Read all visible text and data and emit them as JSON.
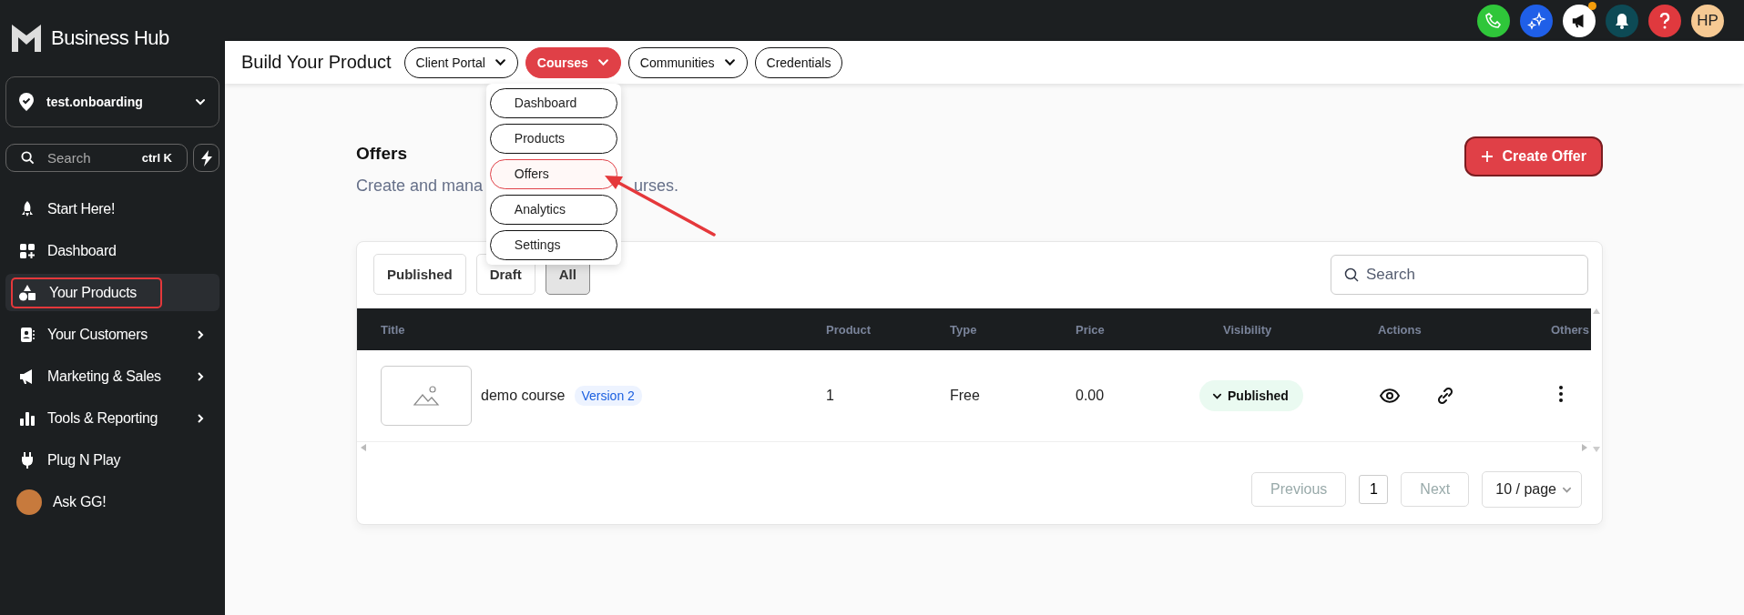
{
  "app": {
    "brand": "Business Hub"
  },
  "sidebar": {
    "account": "test.onboarding",
    "search": {
      "placeholder": "Search",
      "shortcut": "ctrl K"
    },
    "items": [
      {
        "label": "Start Here!",
        "kind": "rocket",
        "has_submenu": false,
        "selected": false
      },
      {
        "label": "Dashboard",
        "kind": "grid",
        "has_submenu": false,
        "selected": false
      },
      {
        "label": "Your Products",
        "kind": "shapes",
        "has_submenu": false,
        "selected": true
      },
      {
        "label": "Your Customers",
        "kind": "contacts",
        "has_submenu": true,
        "selected": false
      },
      {
        "label": "Marketing & Sales",
        "kind": "megaphone",
        "has_submenu": true,
        "selected": false
      },
      {
        "label": "Tools & Reporting",
        "kind": "chart",
        "has_submenu": true,
        "selected": false
      },
      {
        "label": "Plug N Play",
        "kind": "plug",
        "has_submenu": false,
        "selected": false
      },
      {
        "label": "Ask GG!",
        "kind": "avatar",
        "has_submenu": false,
        "selected": false
      }
    ]
  },
  "topbar": {
    "avatar_initials": "HP",
    "announcement_unread": true
  },
  "header": {
    "title": "Build Your Product",
    "tabs": [
      {
        "label": "Client Portal",
        "dropdown": true,
        "selected": false
      },
      {
        "label": "Courses",
        "dropdown": true,
        "selected": true
      },
      {
        "label": "Communities",
        "dropdown": true,
        "selected": false
      },
      {
        "label": "Credentials",
        "dropdown": false,
        "selected": false
      }
    ]
  },
  "menu": {
    "items": [
      {
        "label": "Dashboard",
        "selected": false
      },
      {
        "label": "Products",
        "selected": false
      },
      {
        "label": "Offers",
        "selected": true
      },
      {
        "label": "Analytics",
        "selected": false
      },
      {
        "label": "Settings",
        "selected": false
      }
    ]
  },
  "page": {
    "title": "Offers",
    "subtitle_parts": [
      "Create and mana",
      "urses."
    ],
    "create_button": "Create Offer"
  },
  "filters": [
    {
      "label": "Published",
      "selected": false
    },
    {
      "label": "Draft",
      "selected": false
    },
    {
      "label": "All",
      "selected": true
    }
  ],
  "search": {
    "placeholder": "Search"
  },
  "table": {
    "columns": [
      "Title",
      "Product",
      "Type",
      "Price",
      "Visibility",
      "Actions",
      "Others"
    ],
    "rows": [
      {
        "title": "demo course",
        "version": "Version 2",
        "product": "1",
        "type": "Free",
        "price": "0.00",
        "visibility": "Published"
      }
    ]
  },
  "pagination": {
    "previous": "Previous",
    "page": "1",
    "next": "Next",
    "page_size": "10 / page",
    "previous_disabled": true,
    "next_disabled": true
  }
}
